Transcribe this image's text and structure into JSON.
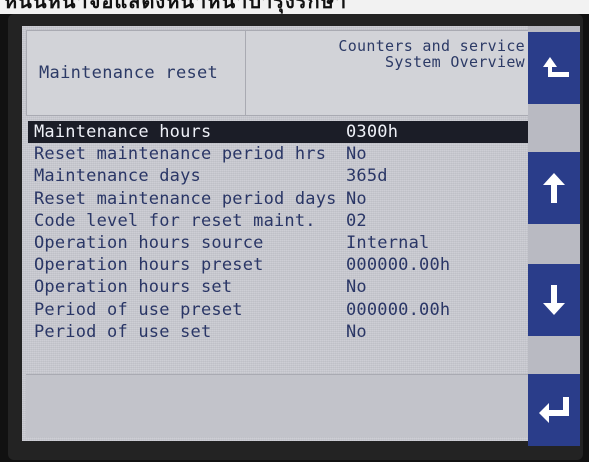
{
  "top_text": "ห่นั่นหน้าจอแสดงหน้าหน้าบำรุงรักษา",
  "header": {
    "title": "Maintenance reset",
    "breadcrumb_line1": "Counters and service",
    "breadcrumb_line2": "System Overview"
  },
  "rows": [
    {
      "label": "Maintenance hours",
      "value": "0300h",
      "selected": true
    },
    {
      "label": "Reset maintenance period hrs",
      "value": "No"
    },
    {
      "label": "Maintenance days",
      "value": "365d"
    },
    {
      "label": "Reset maintenance period days",
      "value": "No"
    },
    {
      "label": "Code level for reset maint.",
      "value": "02"
    },
    {
      "label": "Operation hours source",
      "value": "Internal"
    },
    {
      "label": "Operation hours preset",
      "value": "000000.00h"
    },
    {
      "label": "Operation hours set",
      "value": "No"
    },
    {
      "label": "Period of use preset",
      "value": "000000.00h"
    },
    {
      "label": "Period of use set",
      "value": "No"
    }
  ],
  "nav_buttons": [
    "back-up-arrow-icon",
    "arrow-up-icon",
    "arrow-down-icon",
    "enter-icon"
  ],
  "colors": {
    "screen_bg": "#c9cad1",
    "text": "#2a3666",
    "selected_bg": "#1b1d27",
    "button_bg": "#2a3d8a"
  }
}
